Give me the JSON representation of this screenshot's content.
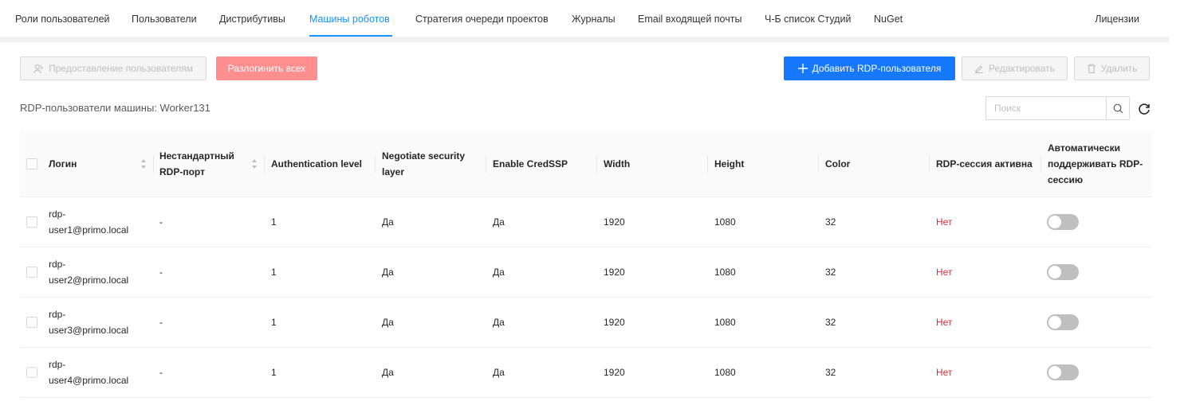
{
  "nav": {
    "tabs": [
      {
        "label": "Роли пользователей"
      },
      {
        "label": "Пользователи"
      },
      {
        "label": "Дистрибутивы"
      },
      {
        "label": "Машины роботов"
      },
      {
        "label": "Стратегия очереди проектов"
      },
      {
        "label": "Журналы"
      },
      {
        "label": "Email входящей почты"
      },
      {
        "label": "Ч-Б список Студий"
      },
      {
        "label": "NuGet"
      }
    ],
    "active": "Машины роботов",
    "licenses": "Лицензии"
  },
  "toolbar": {
    "grant_label": "Предоставление пользователям",
    "logout_all_label": "Разлогинить всех",
    "add_label": "Добавить RDP-пользователя",
    "edit_label": "Редактировать",
    "delete_label": "Удалить"
  },
  "section": {
    "title": "RDP-пользователи машины: Worker131"
  },
  "search": {
    "placeholder": "Поиск"
  },
  "colors": {
    "accent": "#1890ff",
    "primary_button": "#1677ff",
    "danger_light": "#ff8f8f",
    "status_no": "#f5222d"
  },
  "table": {
    "columns": [
      {
        "label": "Логин"
      },
      {
        "label": "Нестандартный RDP-порт"
      },
      {
        "label": "Authentication level"
      },
      {
        "label": "Negotiate security layer"
      },
      {
        "label": "Enable CredSSP"
      },
      {
        "label": "Width"
      },
      {
        "label": "Height"
      },
      {
        "label": "Color"
      },
      {
        "label": "RDP-сессия активна"
      },
      {
        "label": "Автоматически поддерживать RDP-сессию"
      }
    ],
    "rows": [
      {
        "login": "rdp-user1@primo.local",
        "port": "-",
        "auth_level": "1",
        "negotiate": "Да",
        "credssp": "Да",
        "width": "1920",
        "height": "1080",
        "color": "32",
        "active": "Нет",
        "auto_keep": false
      },
      {
        "login": "rdp-user2@primo.local",
        "port": "-",
        "auth_level": "1",
        "negotiate": "Да",
        "credssp": "Да",
        "width": "1920",
        "height": "1080",
        "color": "32",
        "active": "Нет",
        "auto_keep": false
      },
      {
        "login": "rdp-user3@primo.local",
        "port": "-",
        "auth_level": "1",
        "negotiate": "Да",
        "credssp": "Да",
        "width": "1920",
        "height": "1080",
        "color": "32",
        "active": "Нет",
        "auto_keep": false
      },
      {
        "login": "rdp-user4@primo.local",
        "port": "-",
        "auth_level": "1",
        "negotiate": "Да",
        "credssp": "Да",
        "width": "1920",
        "height": "1080",
        "color": "32",
        "active": "Нет",
        "auto_keep": false
      }
    ]
  }
}
